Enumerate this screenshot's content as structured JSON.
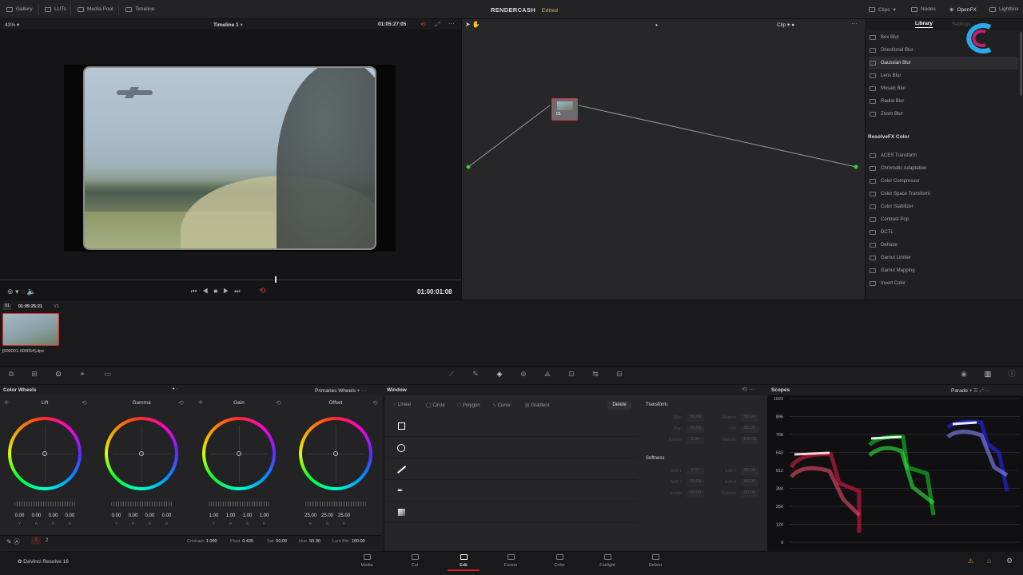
{
  "topbar": {
    "gallery": "Gallery",
    "luts": "LUTs",
    "media_pool": "Media Pool",
    "timeline": "Timeline",
    "project": "RENDERCASH",
    "status": "Edited",
    "clips": "Clips",
    "nodes": "Nodes",
    "openfx": "OpenFX",
    "lightbox": "Lightbox"
  },
  "viewer": {
    "zoom": "43%",
    "timeline_name": "Timeline 1",
    "timecode": "01:05:27:05",
    "playback_tc": "01:00:01:08"
  },
  "nodes": {
    "mode": "Clip",
    "node_label": "01"
  },
  "library": {
    "tab_library": "Library",
    "tab_settings": "Settings",
    "blur_items": [
      "Box Blur",
      "Directional Blur",
      "Gaussian Blur",
      "Lens Blur",
      "Mosaic Blur",
      "Radial Blur",
      "Zoom Blur"
    ],
    "selected": "Gaussian Blur",
    "section": "ResolveFX Color",
    "color_items": [
      "ACES Transform",
      "Chromatic Adaptation",
      "Color Compressor",
      "Color Space Transform",
      "Color Stabilizer",
      "Contrast Pop",
      "DCTL",
      "Dehaze",
      "Gamut Limiter",
      "Gamut Mapping",
      "Invert Color"
    ]
  },
  "clip": {
    "index": "01",
    "tc": "01:05:25:21",
    "track": "V1",
    "name": "[000001-000054].dpx"
  },
  "color_wheels": {
    "title": "Color Wheels",
    "mode": "Primaries Wheels",
    "wheels": [
      {
        "label": "Lift",
        "values": [
          "0.00",
          "0.00",
          "0.00",
          "0.00"
        ]
      },
      {
        "label": "Gamma",
        "values": [
          "0.00",
          "0.00",
          "0.00",
          "0.00"
        ]
      },
      {
        "label": "Gain",
        "values": [
          "1.00",
          "1.00",
          "1.00",
          "1.00"
        ]
      },
      {
        "label": "Offset",
        "values": [
          "25.00",
          "25.00",
          "25.00"
        ]
      }
    ],
    "ch4": [
      "Y",
      "R",
      "G",
      "B"
    ],
    "ch3": [
      "R",
      "G",
      "B"
    ],
    "page_a": "1",
    "page_b": "2",
    "contrast_label": "Contrast",
    "contrast": "1.000",
    "pivot_label": "Pivot",
    "pivot": "0.435",
    "sat_label": "Sat",
    "sat": "50.00",
    "hue_label": "Hue",
    "hue": "50.00",
    "lummix_label": "Lum Mix",
    "lummix": "100.00"
  },
  "window": {
    "title": "Window",
    "tools": [
      "Linear",
      "Circle",
      "Polygon",
      "Curve",
      "Gradient"
    ],
    "delete": "Delete",
    "transform": "Transform",
    "t_fields": [
      [
        "Size",
        "50.00",
        "Aspect",
        "50.00"
      ],
      [
        "Pan",
        "50.00",
        "Tilt",
        "50.00"
      ],
      [
        "Rotate",
        "0.00",
        "Opacity",
        "100.00"
      ]
    ],
    "softness": "Softness",
    "s_fields": [
      [
        "Soft 1",
        "2.07",
        "Soft 2",
        "50.00"
      ],
      [
        "Soft 3",
        "50.00",
        "Soft 4",
        "50.00"
      ],
      [
        "Inside",
        "50.00",
        "Outside",
        "50.00"
      ]
    ]
  },
  "scopes": {
    "title": "Scopes",
    "mode": "Parade",
    "ticks": [
      "1023",
      "896",
      "768",
      "640",
      "512",
      "384",
      "256",
      "128",
      "0"
    ]
  },
  "pages": {
    "app": "DaVinci Resolve 16",
    "items": [
      "Media",
      "Cut",
      "Edit",
      "Fusion",
      "Color",
      "Fairlight",
      "Deliver"
    ],
    "active": "Edit"
  }
}
